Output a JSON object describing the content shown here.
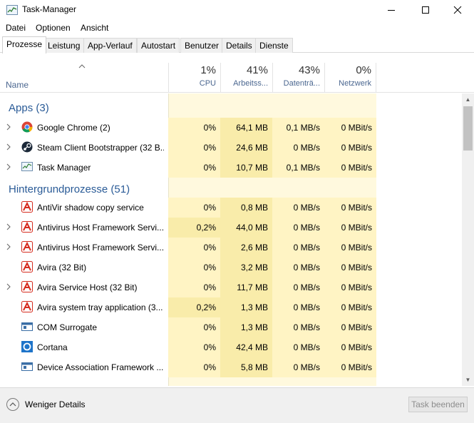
{
  "window": {
    "title": "Task-Manager"
  },
  "menu": [
    "Datei",
    "Optionen",
    "Ansicht"
  ],
  "tabs": [
    "Prozesse",
    "Leistung",
    "App-Verlauf",
    "Autostart",
    "Benutzer",
    "Details",
    "Dienste"
  ],
  "active_tab": "Prozesse",
  "columns": {
    "name": "Name",
    "cpu": {
      "pct": "1%",
      "label": "CPU"
    },
    "mem": {
      "pct": "41%",
      "label": "Arbeitss..."
    },
    "disk": {
      "pct": "43%",
      "label": "Datenträ..."
    },
    "net": {
      "pct": "0%",
      "label": "Netzwerk"
    }
  },
  "groups": {
    "apps": "Apps (3)",
    "background": "Hintergrundprozesse (51)"
  },
  "apps": [
    {
      "name": "Google Chrome (2)",
      "icon": "chrome-icon",
      "expandable": true,
      "cpu": "0%",
      "mem": "64,1 MB",
      "disk": "0,1 MB/s",
      "net": "0 MBit/s"
    },
    {
      "name": "Steam Client Bootstrapper (32 B...",
      "icon": "steam-icon",
      "expandable": true,
      "cpu": "0%",
      "mem": "24,6 MB",
      "disk": "0 MB/s",
      "net": "0 MBit/s"
    },
    {
      "name": "Task Manager",
      "icon": "taskmanager-icon",
      "expandable": true,
      "cpu": "0%",
      "mem": "10,7 MB",
      "disk": "0,1 MB/s",
      "net": "0 MBit/s"
    }
  ],
  "background": [
    {
      "name": "AntiVir shadow copy service",
      "icon": "avira-icon",
      "expandable": false,
      "cpu": "0%",
      "mem": "0,8 MB",
      "disk": "0 MB/s",
      "net": "0 MBit/s"
    },
    {
      "name": "Antivirus Host Framework Servi...",
      "icon": "avira-icon",
      "expandable": true,
      "cpu": "0,2%",
      "mem": "44,0 MB",
      "disk": "0 MB/s",
      "net": "0 MBit/s"
    },
    {
      "name": "Antivirus Host Framework Servi...",
      "icon": "avira-icon",
      "expandable": true,
      "cpu": "0%",
      "mem": "2,6 MB",
      "disk": "0 MB/s",
      "net": "0 MBit/s"
    },
    {
      "name": "Avira (32 Bit)",
      "icon": "avira-icon",
      "expandable": false,
      "cpu": "0%",
      "mem": "3,2 MB",
      "disk": "0 MB/s",
      "net": "0 MBit/s"
    },
    {
      "name": "Avira Service Host (32 Bit)",
      "icon": "avira-icon",
      "expandable": true,
      "cpu": "0%",
      "mem": "11,7 MB",
      "disk": "0 MB/s",
      "net": "0 MBit/s"
    },
    {
      "name": "Avira system tray application (3...",
      "icon": "avira-icon",
      "expandable": false,
      "cpu": "0,2%",
      "mem": "1,3 MB",
      "disk": "0 MB/s",
      "net": "0 MBit/s"
    },
    {
      "name": "COM Surrogate",
      "icon": "com-surrogate-icon",
      "expandable": false,
      "cpu": "0%",
      "mem": "1,3 MB",
      "disk": "0 MB/s",
      "net": "0 MBit/s"
    },
    {
      "name": "Cortana",
      "icon": "cortana-icon",
      "expandable": false,
      "cpu": "0%",
      "mem": "42,4 MB",
      "disk": "0 MB/s",
      "net": "0 MBit/s"
    },
    {
      "name": "Device Association Framework ...",
      "icon": "device-association-icon",
      "expandable": false,
      "cpu": "0%",
      "mem": "5,8 MB",
      "disk": "0 MB/s",
      "net": "0 MBit/s"
    }
  ],
  "footer": {
    "less_details": "Weniger Details",
    "end_task": "Task beenden"
  }
}
